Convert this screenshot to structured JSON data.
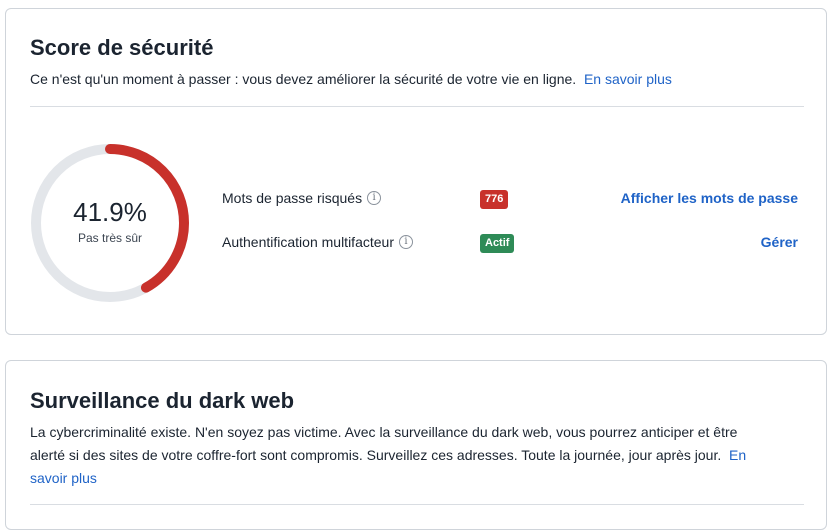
{
  "security_score": {
    "title": "Score de sécurité",
    "description": "Ce n'est qu'un moment à passer : vous devez améliorer la sécurité de votre vie en ligne.",
    "learn_more": "En savoir plus",
    "score_value": "41.9%",
    "score_fraction": 0.419,
    "score_label": "Pas très sûr",
    "colors": {
      "gauge_fill": "#c8312b",
      "gauge_track": "#e3e6ea"
    },
    "rows": [
      {
        "label": "Mots de passe risqués",
        "badge": "776",
        "badge_color": "#c8312b",
        "action": "Afficher les mots de passe"
      },
      {
        "label": "Authentification multifacteur",
        "badge": "Actif",
        "badge_color": "#2e8b57",
        "action": "Gérer"
      }
    ],
    "info_icon_glyph": "i"
  },
  "dark_web": {
    "title": "Surveillance du dark web",
    "description": "La cybercriminalité existe. N'en soyez pas victime. Avec la surveillance du dark web, vous pourrez anticiper et être alerté si des sites de votre coffre-fort sont compromis. Surveillez ces adresses. Toute la journée, jour après jour.",
    "learn_more": "En savoir plus"
  }
}
